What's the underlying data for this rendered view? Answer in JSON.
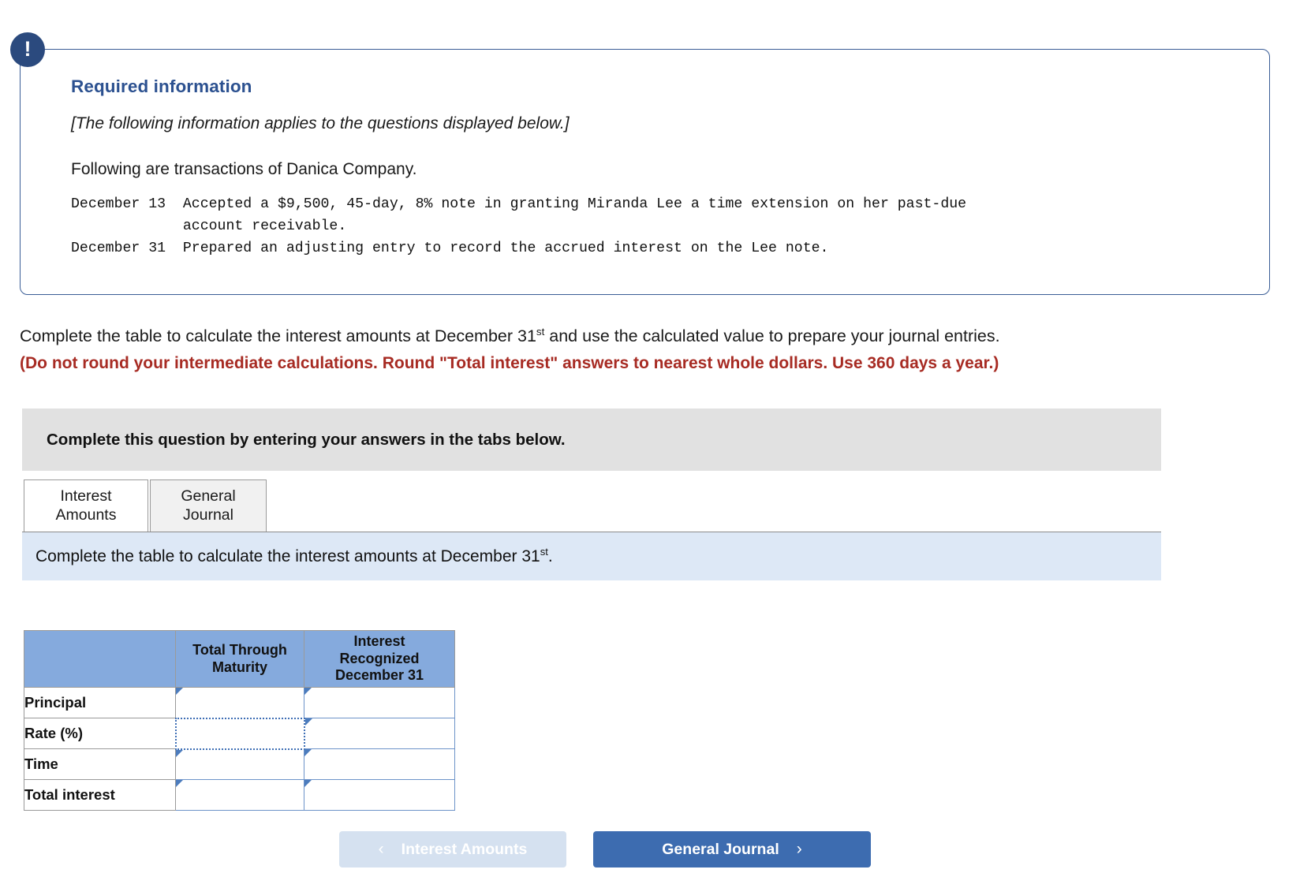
{
  "callout": {
    "badge_icon": "exclamation-icon",
    "title": "Required information",
    "italic_note": "[The following information applies to the questions displayed below.]",
    "intro": "Following are transactions of Danica Company.",
    "transactions": "December 13  Accepted a $9,500, 45-day, 8% note in granting Miranda Lee a time extension on her past-due\n             account receivable.\nDecember 31  Prepared an adjusting entry to record the accrued interest on the Lee note."
  },
  "prompt": {
    "main_before": "Complete the table to calculate the interest amounts at December 31",
    "ordinal": "st",
    "main_after": " and use the calculated value to prepare your journal entries.",
    "red_note": "(Do not round your intermediate calculations. Round \"Total interest\" answers to nearest whole dollars. Use 360 days a year.)"
  },
  "gray_banner": {
    "text": "Complete this question by entering your answers in the tabs below."
  },
  "tabs": [
    {
      "label_line1": "Interest",
      "label_line2": "Amounts",
      "active": true
    },
    {
      "label_line1": "General",
      "label_line2": "Journal",
      "active": false
    }
  ],
  "blue_strip": {
    "text_before": "Complete the table to calculate the interest amounts at December 31",
    "ordinal": "st",
    "text_after": "."
  },
  "table": {
    "headers": {
      "corner": "",
      "col1_line1": "Total Through",
      "col1_line2": "Maturity",
      "col2_line1": "Interest",
      "col2_line2": "Recognized",
      "col2_line3": "December 31"
    },
    "rows": [
      {
        "label": "Principal",
        "total_through_maturity": "",
        "interest_recognized": "",
        "selected_cell": null
      },
      {
        "label": "Rate (%)",
        "total_through_maturity": "",
        "interest_recognized": "",
        "selected_cell": "total_through_maturity"
      },
      {
        "label": "Time",
        "total_through_maturity": "",
        "interest_recognized": "",
        "selected_cell": null
      },
      {
        "label": "Total interest",
        "total_through_maturity": "",
        "interest_recognized": "",
        "selected_cell": null
      }
    ]
  },
  "nav": {
    "prev_label": "Interest Amounts",
    "prev_chevron": "chevron-left-icon",
    "prev_glyph": "‹",
    "next_label": "General Journal",
    "next_chevron": "chevron-right-icon",
    "next_glyph": "›"
  },
  "colors": {
    "callout_border": "#3a5d96",
    "callout_badge": "#2b4a7e",
    "title_blue": "#2c5190",
    "warning_red": "#a72b23",
    "gray_banner": "#e1e1e1",
    "blue_strip": "#dde8f6",
    "table_header": "#85aadd",
    "cell_border": "#6d93c9",
    "btn_primary": "#3d6cb0",
    "btn_disabled": "#d5e1f0"
  }
}
